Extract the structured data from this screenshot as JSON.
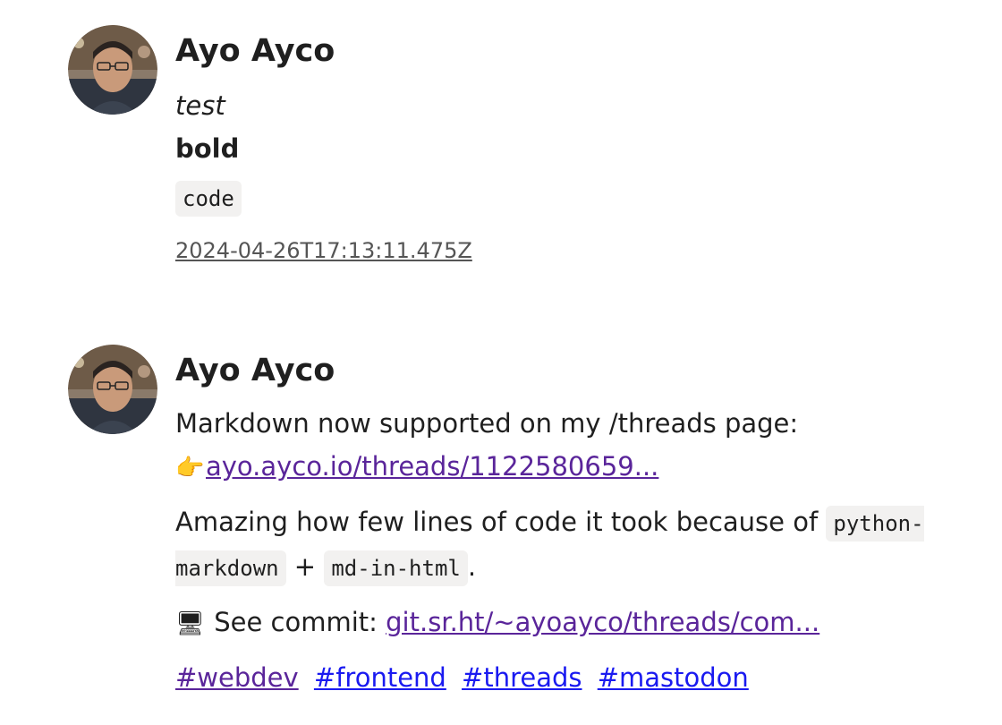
{
  "colors": {
    "text": "#1f1f1f",
    "link_visited": "#5a259a",
    "link": "#1a1af0",
    "code_bg": "#f2f1f0",
    "timestamp": "#555555"
  },
  "posts": [
    {
      "author": "Ayo Ayco",
      "lines": {
        "italic": "test",
        "bold": "bold",
        "code": "code"
      },
      "timestamp": "2024-04-26T17:13:11.475Z"
    },
    {
      "author": "Ayo Ayco",
      "intro": "Markdown now supported on my /threads page:",
      "pointer_emoji": "👉",
      "thread_link": "ayo.ayco.io/threads/1122580659...",
      "amazing_prefix": "Amazing how few lines of code it took because of ",
      "code1": "python-markdown",
      "plus": " + ",
      "code2": "md-in-html",
      "period": ".",
      "commit_emoji": "🖥",
      "see_commit": " See commit: ",
      "commit_link": "git.sr.ht/~ayoayco/threads/com...",
      "tags": [
        "#webdev",
        "#frontend",
        "#threads",
        "#mastodon"
      ]
    }
  ]
}
